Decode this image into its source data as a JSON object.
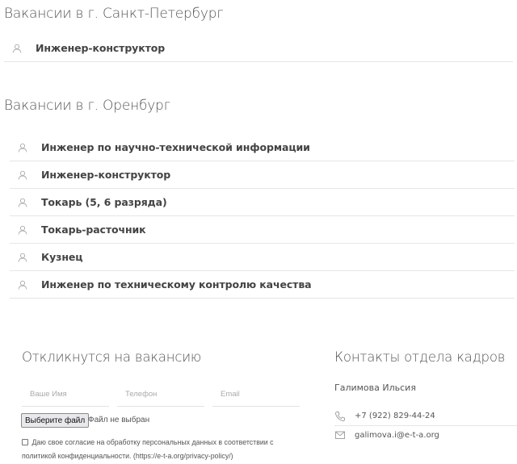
{
  "sections": [
    {
      "title": "Вакансии в г. Санкт-Петербург",
      "items": [
        {
          "label": "Инженер-конструктор"
        }
      ]
    },
    {
      "title": "Вакансии в г. Оренбург",
      "items": [
        {
          "label": "Инженер по научно-технической информации"
        },
        {
          "label": "Инженер-конструктор"
        },
        {
          "label": "Токарь (5, 6 разряда)"
        },
        {
          "label": "Токарь-расточник"
        },
        {
          "label": "Кузнец"
        },
        {
          "label": "Инженер по техническому контролю качества"
        }
      ]
    }
  ],
  "form": {
    "title": "Откликнутся на вакансию",
    "name_placeholder": "Ваше Имя",
    "phone_placeholder": "Телефон",
    "email_placeholder": "Email",
    "file_button_label": "Выберите файл",
    "file_status": "Файл не выбран",
    "consent_text": "Даю свое согласие на обработку персональных данных в соответствии с политикой конфиденциальности. (https://e-t-a.org/privacy-policy/)"
  },
  "contacts": {
    "title": "Контакты отдела кадров",
    "name": "Галимова Ильсия",
    "phone": "+7 (922) 829-44-24",
    "email": "galimova.i@e-t-a.org",
    "icons": {
      "vacancy": "user-icon",
      "phone": "phone-icon",
      "email": "mail-icon"
    }
  },
  "colors": {
    "text": "#555555",
    "label": "#444444",
    "divider": "#e6e6e6",
    "icon": "#aaaaaa"
  }
}
